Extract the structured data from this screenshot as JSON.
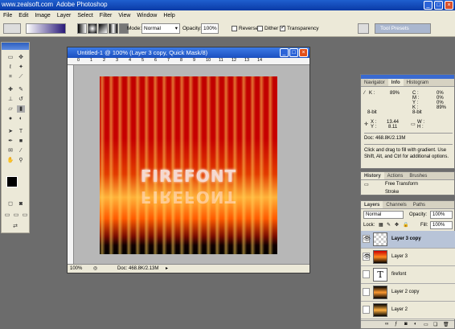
{
  "titlebar": {
    "watermark": "www.zealsoft.com",
    "app_title": "Adobe Photoshop"
  },
  "menu": [
    "File",
    "Edit",
    "Image",
    "Layer",
    "Select",
    "Filter",
    "View",
    "Window",
    "Help"
  ],
  "options": {
    "mode_label": "Mode:",
    "mode_value": "Normal",
    "opacity_label": "Opacity:",
    "opacity_value": "100%",
    "reverse_label": "Reverse",
    "dither_label": "Dither",
    "transparency_label": "Transparency",
    "tool_presets": "Tool Presets"
  },
  "document": {
    "title": "Untitled-1 @ 100% (Layer 3 copy, Quick Mask/8)",
    "ruler_marks": [
      "0",
      "1",
      "2",
      "3",
      "4",
      "5",
      "6",
      "7",
      "8",
      "9",
      "10",
      "11",
      "12",
      "13",
      "14"
    ],
    "canvas_text": "FIREFONT",
    "zoom": "100%",
    "doc_size": "Doc: 468.8K/2.13M"
  },
  "info_panel": {
    "tabs": [
      "Navigator",
      "Info",
      "Histogram"
    ],
    "k_label": "K :",
    "k_value": "89%",
    "bit1": "8-bit",
    "c_label": "C :",
    "c_value": "0%",
    "m_label": "M :",
    "m_value": "0%",
    "y_label": "Y :",
    "y_value": "0%",
    "k2_label": "K :",
    "k2_value": "89%",
    "bit2": "8-bit",
    "x_label": "X :",
    "x_value": "13.44",
    "y2_label": "Y :",
    "y2_value": "8.11",
    "w_label": "W :",
    "h_label": "H :",
    "doc": "Doc: 468.8K/2.13M",
    "hint": "Click and drag to fill with gradient. Use Shift, Alt, and Ctrl for additional options."
  },
  "history_panel": {
    "tabs": [
      "History",
      "Actions",
      "Brushes"
    ],
    "items": [
      "Free Transform",
      "Stroke"
    ]
  },
  "layers_panel": {
    "tabs": [
      "Layers",
      "Channels",
      "Paths"
    ],
    "blend_mode": "Normal",
    "opacity_label": "Opacity:",
    "opacity_value": "100%",
    "lock_label": "Lock:",
    "fill_label": "Fill:",
    "fill_value": "100%",
    "layers": [
      {
        "name": "Layer 3 copy",
        "visible": true,
        "selected": true,
        "thumb": "checker"
      },
      {
        "name": "Layer 3",
        "visible": true,
        "selected": false,
        "thumb": "fire"
      },
      {
        "name": "firefont",
        "visible": false,
        "selected": false,
        "thumb": "text"
      },
      {
        "name": "Layer 2 copy",
        "visible": false,
        "selected": false,
        "thumb": "fire"
      },
      {
        "name": "Layer 2",
        "visible": false,
        "selected": false,
        "thumb": "fire"
      }
    ]
  }
}
